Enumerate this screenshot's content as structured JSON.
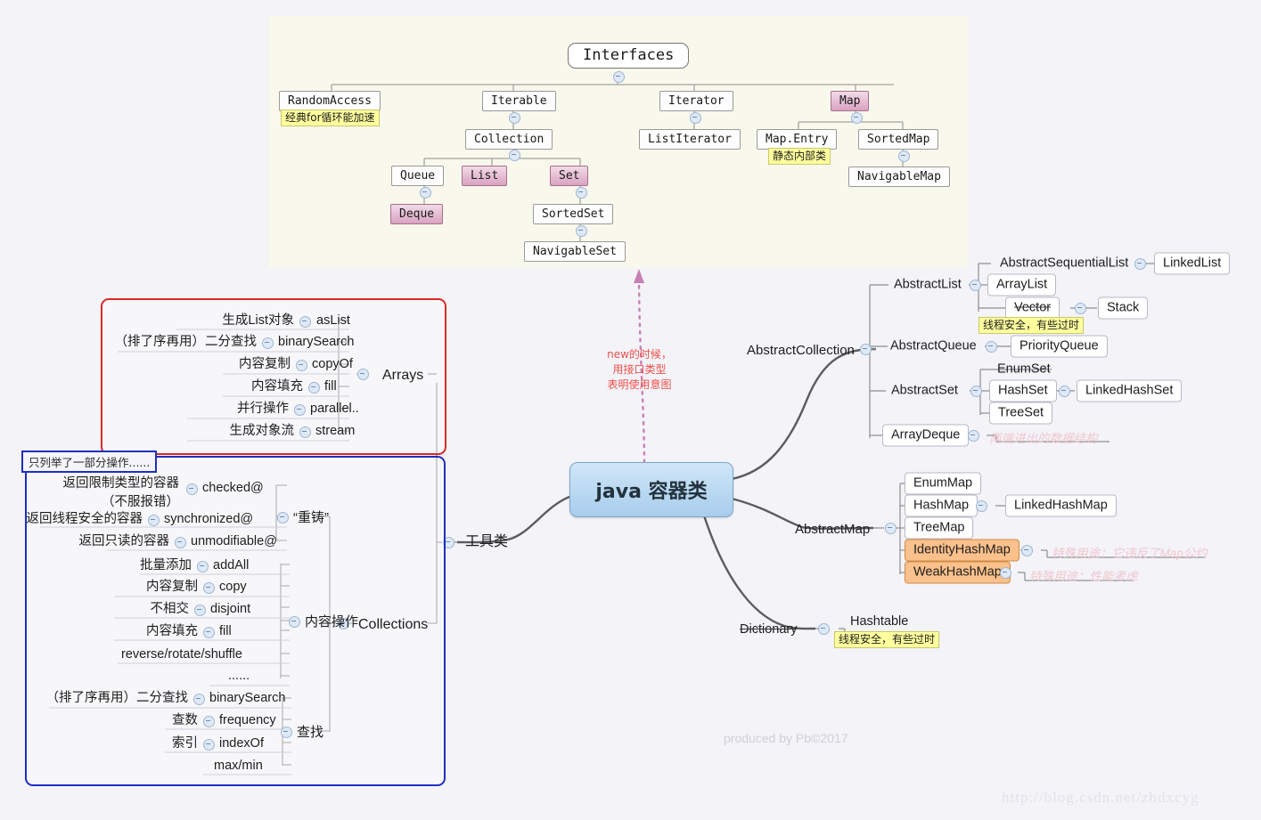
{
  "canvas": {
    "bg": "#f3f3f8",
    "panel_bg": "#f8f8ec",
    "accent_red": "#d92a2a",
    "accent_blue": "#1f2fbf",
    "note_yellow": "#ffff9e",
    "orange": "#fbc18c"
  },
  "center": {
    "label": "java 容器类"
  },
  "dashed_annotation": {
    "line1": "new的时候，",
    "line2": "用接口类型",
    "line3": "表明使用意图"
  },
  "interfaces": {
    "root": "Interfaces",
    "nodes": {
      "random_access": "RandomAccess",
      "random_access_note": "经典for循环能加速",
      "iterable": "Iterable",
      "collection": "Collection",
      "queue": "Queue",
      "list": "List",
      "set": "Set",
      "deque": "Deque",
      "sorted_set": "SortedSet",
      "navigable_set": "NavigableSet",
      "iterator": "Iterator",
      "list_iterator": "ListIterator",
      "map": "Map",
      "map_entry": "Map.Entry",
      "map_entry_note": "静态内部类",
      "sorted_map": "SortedMap",
      "navigable_map": "NavigableMap"
    }
  },
  "tools_branch": {
    "label": "工具类"
  },
  "arrays": {
    "title": "Arrays",
    "items": [
      {
        "label": "生成List对象",
        "method": "asList"
      },
      {
        "label": "（排了序再用）二分查找",
        "method": "binarySearch"
      },
      {
        "label": "内容复制",
        "method": "copyOf"
      },
      {
        "label": "内容填充",
        "method": "fill"
      },
      {
        "label": "并行操作",
        "method": "parallel.."
      },
      {
        "label": "生成对象流",
        "method": "stream"
      }
    ]
  },
  "collections": {
    "tag": "只列举了一部分操作......",
    "title": "Collections",
    "groups": [
      {
        "name": "“重铸”"
      },
      {
        "name": "内容操作"
      },
      {
        "name": "查找"
      }
    ],
    "recast_items": [
      {
        "label": "返回限制类型的容器\n（不服报错）",
        "label_l1": "返回限制类型的容器",
        "label_l2": "（不服报错）",
        "method": "checked@"
      },
      {
        "label": "返回线程安全的容器",
        "method": "synchronized@"
      },
      {
        "label": "返回只读的容器",
        "method": "unmodifiable@"
      }
    ],
    "content_items": [
      {
        "label": "批量添加",
        "method": "addAll"
      },
      {
        "label": "内容复制",
        "method": "copy"
      },
      {
        "label": "不相交",
        "method": "disjoint"
      },
      {
        "label": "内容填充",
        "method": "fill"
      },
      {
        "label": "",
        "method": "reverse/rotate/shuffle"
      },
      {
        "label": "",
        "method": "......"
      }
    ],
    "search_items": [
      {
        "label": "（排了序再用）二分查找",
        "method": "binarySearch"
      },
      {
        "label": "查数",
        "method": "frequency"
      },
      {
        "label": "索引",
        "method": "indexOf"
      },
      {
        "label": "",
        "method": "max/min"
      }
    ]
  },
  "abstract_collection": {
    "label": "AbstractCollection",
    "abstract_list": {
      "label": "AbstractList",
      "abstract_sequential_list": "AbstractSequentialList",
      "linked_list": "LinkedList",
      "array_list": "ArrayList",
      "vector": "Vector",
      "vector_note": "线程安全，有些过时",
      "stack": "Stack"
    },
    "abstract_queue": {
      "label": "AbstractQueue",
      "priority_queue": "PriorityQueue"
    },
    "abstract_set": {
      "label": "AbstractSet",
      "enum_set": "EnumSet",
      "hash_set": "HashSet",
      "linked_hash_set": "LinkedHashSet",
      "tree_set": "TreeSet"
    },
    "array_deque": {
      "label": "ArrayDeque",
      "note": "两端进出的数据结构"
    }
  },
  "abstract_map": {
    "label": "AbstractMap",
    "enum_map": "EnumMap",
    "hash_map": "HashMap",
    "linked_hash_map": "LinkedHashMap",
    "tree_map": "TreeMap",
    "identity_hash_map": "IdentityHashMap",
    "identity_note": "特殊用途：它违反了Map公约",
    "weak_hash_map": "WeakHashMap",
    "weak_note": "特殊用途：性能考虑"
  },
  "dictionary": {
    "label": "Dictionary",
    "hashtable": "Hashtable",
    "hashtable_note": "线程安全，有些过时"
  },
  "watermarks": {
    "produced": "produced by Pb©2017",
    "url": "http://blog.csdn.net/zbdxcyg"
  }
}
